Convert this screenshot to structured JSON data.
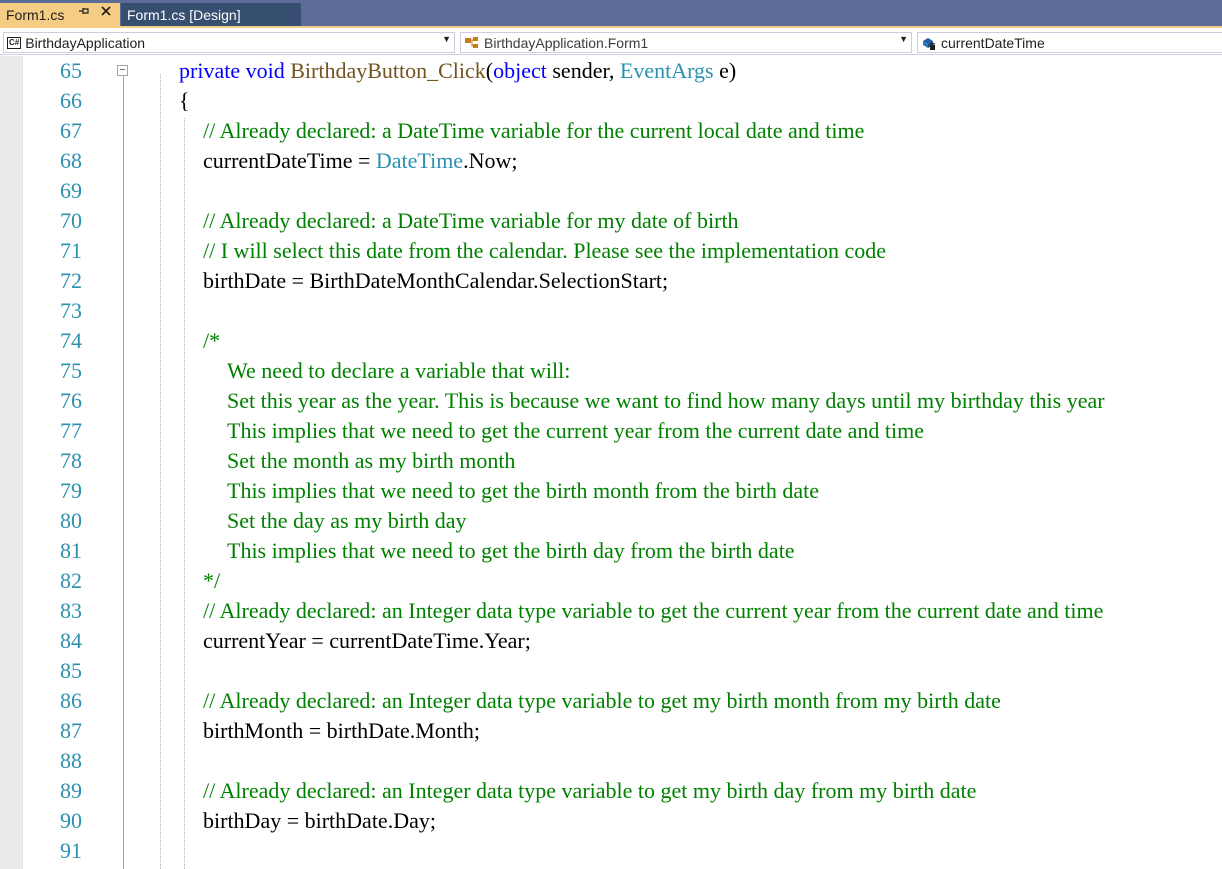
{
  "tabs": [
    {
      "label": "Form1.cs",
      "active": true
    },
    {
      "label": "Form1.cs [Design]",
      "active": false
    }
  ],
  "tab_icons": {
    "pin": "pin-icon",
    "close": "close-icon"
  },
  "navbar": {
    "project": "BirthdayApplication",
    "project_icon": "csharp-project-icon",
    "class": "BirthdayApplication.Form1",
    "class_icon": "class-icon",
    "member": "currentDateTime",
    "member_icon": "field-icon"
  },
  "colors": {
    "keyword": "#0000ff",
    "type": "#2b91af",
    "method": "#74531f",
    "comment": "#008000",
    "line_number": "#2b91af",
    "active_tab": "#f5cc84",
    "tab_strip": "#5d6b99"
  },
  "editor": {
    "lines": [
      {
        "num": "65",
        "indent": 0,
        "tokens": [
          {
            "t": "private ",
            "k": "kw"
          },
          {
            "t": "void ",
            "k": "kw"
          },
          {
            "t": "BirthdayButton_Click",
            "k": "mth"
          },
          {
            "t": "(",
            "k": "plain"
          },
          {
            "t": "object ",
            "k": "kw"
          },
          {
            "t": "sender, ",
            "k": "plain"
          },
          {
            "t": "EventArgs ",
            "k": "ty"
          },
          {
            "t": "e)",
            "k": "plain"
          }
        ]
      },
      {
        "num": "66",
        "indent": 0,
        "tokens": [
          {
            "t": "{",
            "k": "plain"
          }
        ]
      },
      {
        "num": "67",
        "indent": 1,
        "tokens": [
          {
            "t": "// Already declared: a DateTime variable for the current local date and time",
            "k": "cm"
          }
        ]
      },
      {
        "num": "68",
        "indent": 1,
        "tokens": [
          {
            "t": "currentDateTime = ",
            "k": "plain"
          },
          {
            "t": "DateTime",
            "k": "ty"
          },
          {
            "t": ".Now;",
            "k": "plain"
          }
        ]
      },
      {
        "num": "69",
        "indent": 1,
        "tokens": []
      },
      {
        "num": "70",
        "indent": 1,
        "tokens": [
          {
            "t": "// Already declared: a DateTime variable for my date of birth",
            "k": "cm"
          }
        ]
      },
      {
        "num": "71",
        "indent": 1,
        "tokens": [
          {
            "t": "// I will select this date from the calendar. Please see the implementation code",
            "k": "cm"
          }
        ]
      },
      {
        "num": "72",
        "indent": 1,
        "tokens": [
          {
            "t": "birthDate = BirthDateMonthCalendar.SelectionStart;",
            "k": "plain"
          }
        ]
      },
      {
        "num": "73",
        "indent": 1,
        "tokens": []
      },
      {
        "num": "74",
        "indent": 1,
        "tokens": [
          {
            "t": "/*",
            "k": "cm"
          }
        ]
      },
      {
        "num": "75",
        "indent": 2,
        "tokens": [
          {
            "t": "We need to declare a variable that will:",
            "k": "cm"
          }
        ]
      },
      {
        "num": "76",
        "indent": 2,
        "tokens": [
          {
            "t": "Set this year as the year. This is because we want to find how many days until my birthday this year",
            "k": "cm"
          }
        ]
      },
      {
        "num": "77",
        "indent": 2,
        "tokens": [
          {
            "t": "This implies that we need to get the current year from the current date and time",
            "k": "cm"
          }
        ]
      },
      {
        "num": "78",
        "indent": 2,
        "tokens": [
          {
            "t": "Set the month as my birth month",
            "k": "cm"
          }
        ]
      },
      {
        "num": "79",
        "indent": 2,
        "tokens": [
          {
            "t": "This implies that we need to get the birth month from the birth date",
            "k": "cm"
          }
        ]
      },
      {
        "num": "80",
        "indent": 2,
        "tokens": [
          {
            "t": "Set the day as my birth day",
            "k": "cm"
          }
        ]
      },
      {
        "num": "81",
        "indent": 2,
        "tokens": [
          {
            "t": "This implies that we need to get the birth day from the birth date",
            "k": "cm"
          }
        ]
      },
      {
        "num": "82",
        "indent": 1,
        "tokens": [
          {
            "t": "*/",
            "k": "cm"
          }
        ]
      },
      {
        "num": "83",
        "indent": 1,
        "tokens": [
          {
            "t": "// Already declared: an Integer data type variable to get the current year from the current date and time",
            "k": "cm"
          }
        ]
      },
      {
        "num": "84",
        "indent": 1,
        "tokens": [
          {
            "t": "currentYear = currentDateTime.Year;",
            "k": "plain"
          }
        ]
      },
      {
        "num": "85",
        "indent": 1,
        "tokens": []
      },
      {
        "num": "86",
        "indent": 1,
        "tokens": [
          {
            "t": "// Already declared: an Integer data type variable to get my birth month from my birth date",
            "k": "cm"
          }
        ]
      },
      {
        "num": "87",
        "indent": 1,
        "tokens": [
          {
            "t": "birthMonth = birthDate.Month;",
            "k": "plain"
          }
        ]
      },
      {
        "num": "88",
        "indent": 1,
        "tokens": []
      },
      {
        "num": "89",
        "indent": 1,
        "tokens": [
          {
            "t": "// Already declared: an Integer data type variable to get my birth day from my birth date",
            "k": "cm"
          }
        ]
      },
      {
        "num": "90",
        "indent": 1,
        "tokens": [
          {
            "t": "birthDay = birthDate.Day;",
            "k": "plain"
          }
        ]
      },
      {
        "num": "91",
        "indent": 1,
        "tokens": []
      }
    ]
  }
}
